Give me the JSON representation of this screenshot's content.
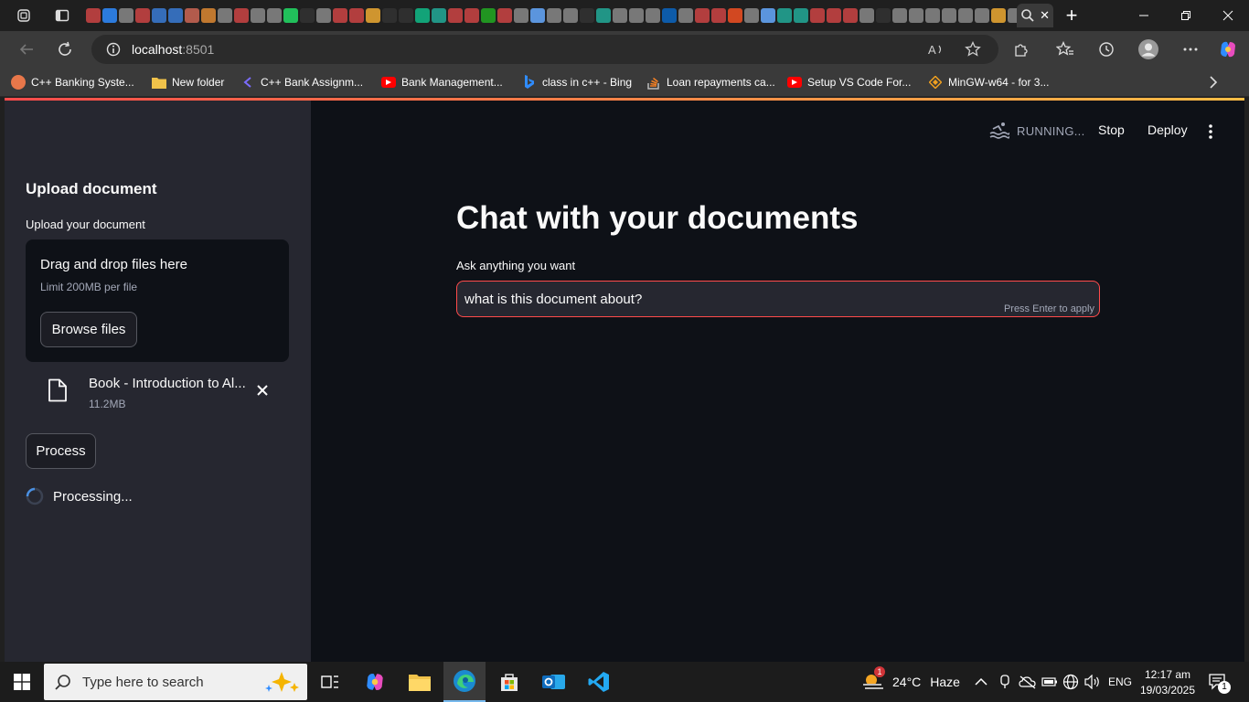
{
  "browser": {
    "active_tab_close": "✕",
    "new_tab": "+",
    "address": {
      "host": "localhost",
      "port": ":8501"
    },
    "bookmarks": [
      {
        "label": "C++ Banking Syste...",
        "icon": "orange-circle-icon",
        "color": "#e8774a"
      },
      {
        "label": "New folder",
        "icon": "folder-icon",
        "color": "#f0c24a"
      },
      {
        "label": "C++ Bank Assignm...",
        "icon": "chevron-left-icon",
        "color": "#7b6cff"
      },
      {
        "label": "Bank Management...",
        "icon": "youtube-icon",
        "color": "#ff0000"
      },
      {
        "label": "class in c++ - Bing",
        "icon": "bing-icon",
        "color": "#2f8cff"
      },
      {
        "label": "Loan repayments ca...",
        "icon": "stackoverflow-icon",
        "color": "#f48024"
      },
      {
        "label": "Setup VS Code For...",
        "icon": "youtube-icon",
        "color": "#ff0000"
      },
      {
        "label": "MinGW-w64 - for 3...",
        "icon": "diamond-icon",
        "color": "#f0a020"
      }
    ]
  },
  "sidebar": {
    "header": "Upload document",
    "upload_label": "Upload your document",
    "dropzone": {
      "title": "Drag and drop files here",
      "limit": "Limit 200MB per file",
      "browse": "Browse files"
    },
    "file": {
      "name": "Book - Introduction to Al...",
      "size": "11.2MB"
    },
    "process_button": "Process",
    "processing_text": "Processing..."
  },
  "header": {
    "status": "RUNNING...",
    "stop": "Stop",
    "deploy": "Deploy"
  },
  "main": {
    "title": "Chat with your documents",
    "ask_label": "Ask anything you want",
    "ask_value": "what is this document about?",
    "ask_hint": "Press Enter to apply"
  },
  "taskbar": {
    "search_placeholder": "Type here to search",
    "weather": {
      "temp": "24°C",
      "condition": "Haze",
      "badge": "1"
    },
    "language": "ENG",
    "time": "12:17 am",
    "date": "19/03/2025",
    "notifications": "1"
  },
  "colors": {
    "accent": "#ff4b4b",
    "app_bg": "#0e1117",
    "sidebar_bg": "#262730",
    "chrome_bg": "#3a3a3a"
  }
}
